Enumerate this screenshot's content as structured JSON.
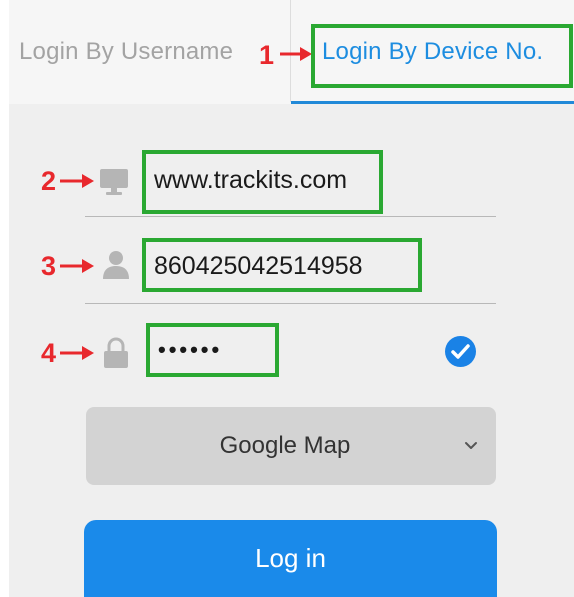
{
  "tabs": {
    "username_label": "Login By Username",
    "device_label": "Login By Device No.",
    "active": "device"
  },
  "annotations": [
    "1",
    "2",
    "3",
    "4"
  ],
  "fields": {
    "server": {
      "value": "www.trackits.com",
      "icon": "monitor-icon"
    },
    "device_no": {
      "value": "860425042514958",
      "icon": "user-icon"
    },
    "password": {
      "value": "••••••",
      "icon": "lock-icon",
      "remember_checked": true
    }
  },
  "map_select": {
    "value": "Google Map",
    "icon": "chevron-down-icon"
  },
  "login_button": {
    "label": "Log in"
  },
  "colors": {
    "accent": "#1a8aea",
    "annotation_box": "#2aa832",
    "annotation_number": "#e8282d"
  }
}
